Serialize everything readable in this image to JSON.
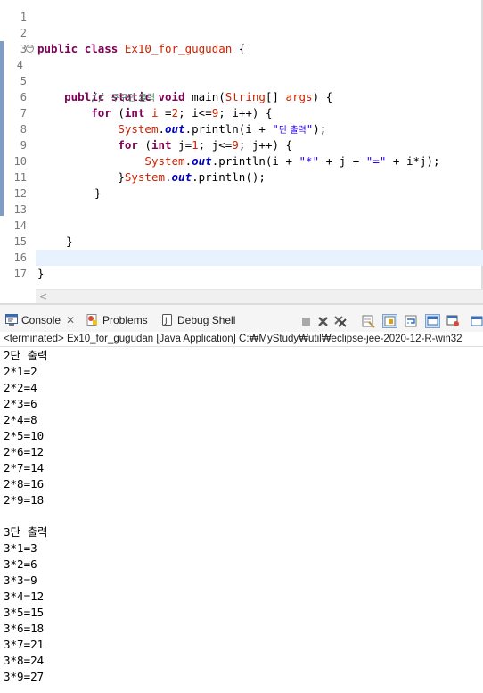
{
  "editor": {
    "lines": [
      {
        "n": "1",
        "code": ""
      },
      {
        "n": "2",
        "code": "public class Ex10_for_gugudan {"
      },
      {
        "n": "3",
        "code": ""
      },
      {
        "n": "4⊖",
        "code": "public static void main(String[] args) {"
      },
      {
        "n": "5",
        "code": "// 구구단 출력"
      },
      {
        "n": "6",
        "code": "for (int i =2; i<=9; i++) {"
      },
      {
        "n": "7",
        "code": "System.out.println(i + \"단 출력\");"
      },
      {
        "n": "8",
        "code": "for (int j=1; j<=9; j++) {"
      },
      {
        "n": "9",
        "code": "System.out.println(i + \"*\" + j + \"=\" + i*j);"
      },
      {
        "n": "10",
        "code": "}System.out.println();"
      },
      {
        "n": "11",
        "code": "}"
      },
      {
        "n": "12",
        "code": ""
      },
      {
        "n": "13",
        "code": ""
      },
      {
        "n": "14",
        "code": "}"
      },
      {
        "n": "15",
        "code": ""
      },
      {
        "n": "16",
        "code": "}"
      },
      {
        "n": "17",
        "code": ""
      }
    ]
  },
  "console_view": {
    "tabs": {
      "console": "Console",
      "close": "✕",
      "problems": "Problems",
      "debug_shell": "Debug Shell"
    },
    "status": "<terminated> Ex10_for_gugudan [Java Application] C:₩MyStudy₩util₩eclipse-jee-2020-12-R-win32",
    "output": [
      "2단 출력",
      "2*1=2",
      "2*2=4",
      "2*3=6",
      "2*4=8",
      "2*5=10",
      "2*6=12",
      "2*7=14",
      "2*8=16",
      "2*9=18",
      "",
      "3단 출력",
      "3*1=3",
      "3*2=6",
      "3*3=9",
      "3*4=12",
      "3*5=15",
      "3*6=18",
      "3*7=21",
      "3*8=24",
      "3*9=27"
    ]
  },
  "colors": {
    "keyword": "#7f0055",
    "string": "#2a00ff",
    "comment": "#3f7f5f",
    "field": "#0000c0",
    "current_line": "#e8f2fe"
  }
}
